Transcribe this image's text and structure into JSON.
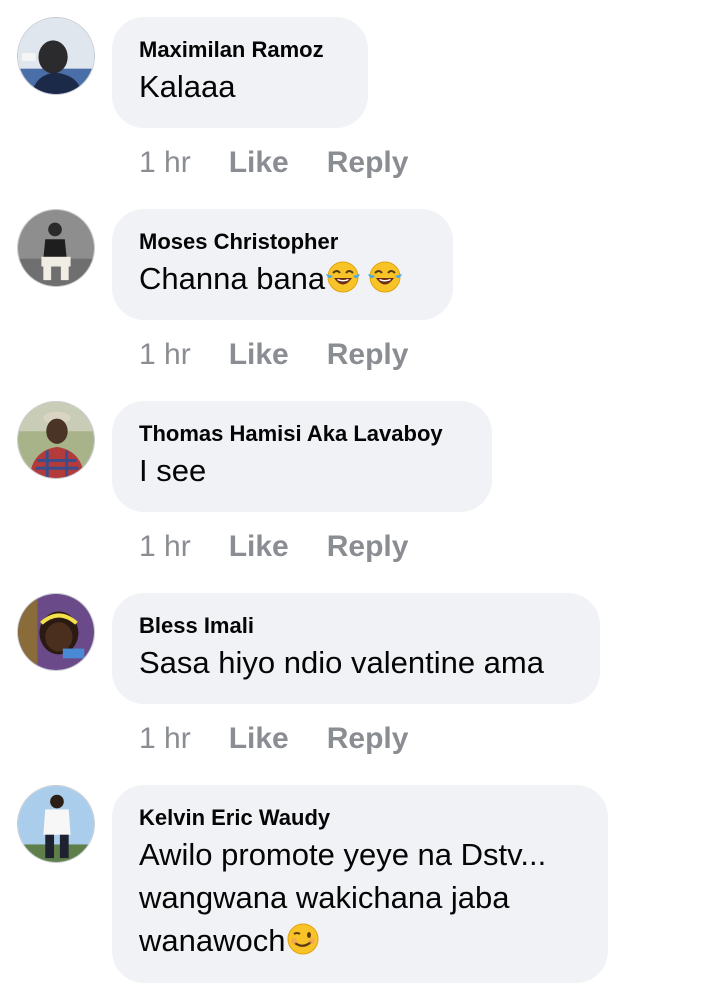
{
  "comments": [
    {
      "author": "Maximilan Ramoz",
      "text": "Kalaaa",
      "time": "1 hr",
      "like_label": "Like",
      "reply_label": "Reply"
    },
    {
      "author": "Moses Christopher",
      "text": "Channa bana",
      "emoji": [
        "face-with-tears-of-joy-icon",
        "face-with-tears-of-joy-icon"
      ],
      "time": "1 hr",
      "like_label": "Like",
      "reply_label": "Reply"
    },
    {
      "author": "Thomas Hamisi Aka Lavaboy",
      "text": "I see",
      "time": "1 hr",
      "like_label": "Like",
      "reply_label": "Reply"
    },
    {
      "author": "Bless Imali",
      "text": "Sasa hiyo ndio valentine ama",
      "time": "1 hr",
      "like_label": "Like",
      "reply_label": "Reply"
    },
    {
      "author": "Kelvin Eric Waudy",
      "text_lines": [
        "Awilo promote yeye na Dstv...",
        "wangwana wakichana jaba",
        "wanawoch"
      ],
      "emoji": [
        "winking-face-icon"
      ]
    }
  ],
  "colors": {
    "bubble": "#f0f2f5",
    "text": "#050505",
    "meta": "#8a8d91"
  }
}
